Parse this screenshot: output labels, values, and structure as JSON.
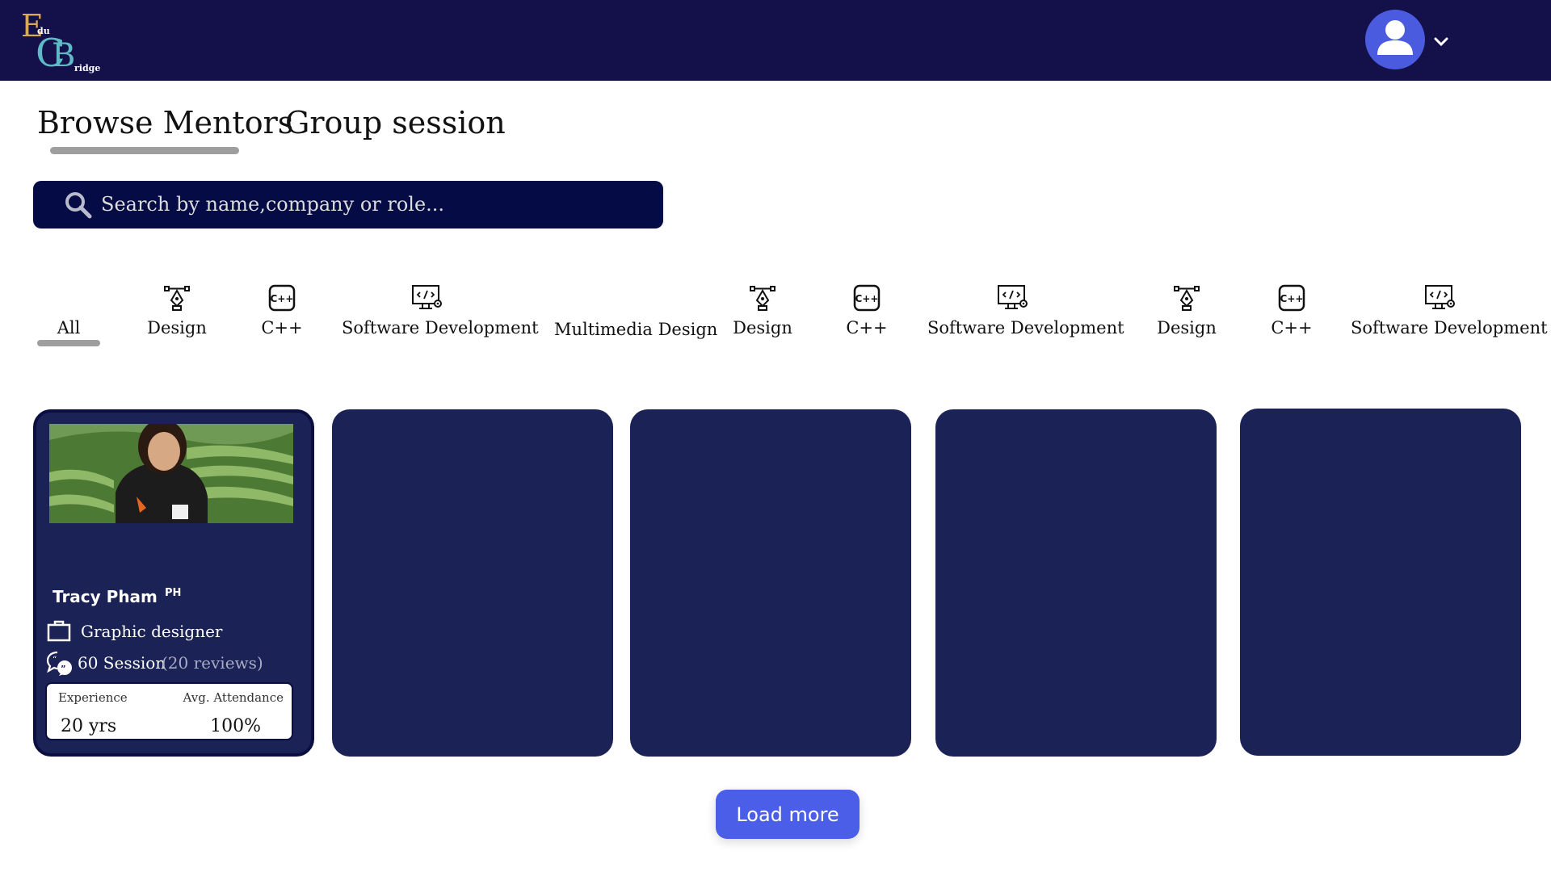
{
  "header": {
    "logo": {
      "e": "E",
      "du": "du",
      "c": "C",
      "b": "B",
      "ridge": "ridge"
    },
    "avatar_icon": "user-avatar-icon",
    "menu_icon": "chevron-down-icon"
  },
  "tabs": [
    {
      "label": "Browse Mentors",
      "active": true
    },
    {
      "label": "Group session",
      "active": false
    }
  ],
  "search": {
    "placeholder": "Search by name,company or role...",
    "value": "",
    "icon": "search-icon"
  },
  "categories": [
    {
      "label": "All",
      "icon": "",
      "active": true
    },
    {
      "label": "Design",
      "icon": "pen-tool-icon"
    },
    {
      "label": "C++",
      "icon": "cpp-icon"
    },
    {
      "label": "Software Development",
      "icon": "code-monitor-icon"
    },
    {
      "label": "Multimedia Design",
      "icon": ""
    },
    {
      "label": "Design",
      "icon": "pen-tool-icon"
    },
    {
      "label": "C++",
      "icon": "cpp-icon"
    },
    {
      "label": "Software Development",
      "icon": "code-monitor-icon"
    },
    {
      "label": "Design",
      "icon": "pen-tool-icon"
    },
    {
      "label": "C++",
      "icon": "cpp-icon"
    },
    {
      "label": "Software Development",
      "icon": "code-monitor-icon"
    }
  ],
  "mentor": {
    "name": "Tracy Pham",
    "country": "PH",
    "role": "Graphic designer",
    "sessions": "60 Session",
    "reviews": "(20 reviews)",
    "experience_label": "Experience",
    "experience_value": "20 yrs",
    "attendance_label": "Avg. Attendance",
    "attendance_value": "100%"
  },
  "load_more_label": "Load more",
  "colors": {
    "header_bg": "#14104a",
    "search_bg": "#050b44",
    "card_bg": "#1b2255",
    "accent": "#4b5ee8"
  }
}
